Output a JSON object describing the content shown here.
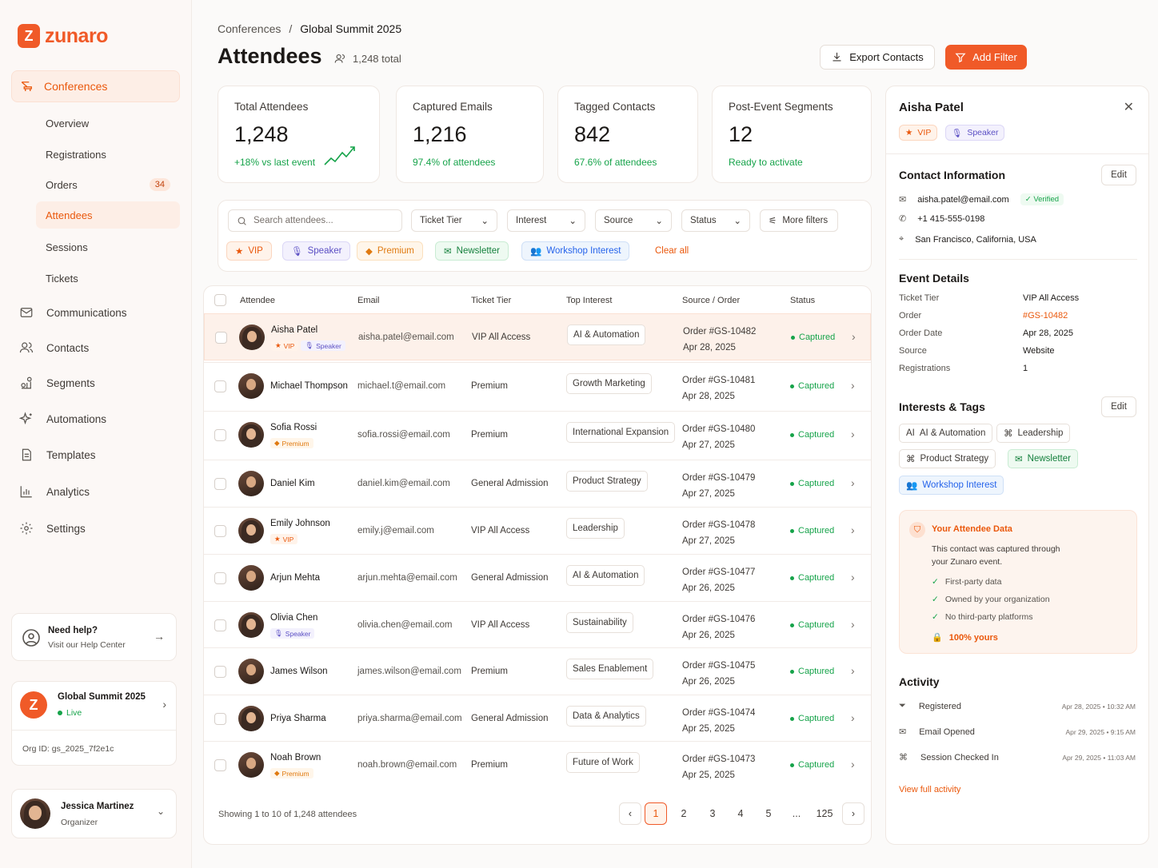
{
  "brand": {
    "name": "zunaro",
    "accent": "#f05a28"
  },
  "sidebar": {
    "main": "Conferences",
    "subitems": [
      {
        "label": "Overview"
      },
      {
        "label": "Registrations"
      },
      {
        "label": "Orders",
        "badge": "34"
      },
      {
        "label": "Attendees"
      },
      {
        "label": "Sessions"
      },
      {
        "label": "Tickets"
      }
    ],
    "items": [
      {
        "label": "Communications",
        "icon": "mail-icon"
      },
      {
        "label": "Contacts",
        "icon": "users-icon"
      },
      {
        "label": "Segments",
        "icon": "segments-icon"
      },
      {
        "label": "Automations",
        "icon": "sparkle-icon"
      },
      {
        "label": "Templates",
        "icon": "document-icon"
      },
      {
        "label": "Analytics",
        "icon": "bar-chart-icon"
      },
      {
        "label": "Settings",
        "icon": "gear-icon"
      }
    ],
    "help": {
      "title": "Need help?",
      "subtitle": "Visit our Help Center"
    },
    "event": {
      "name": "Global Summit 2025",
      "status": "Live",
      "org_id": "Org ID: gs_2025_7f2e1c"
    },
    "user": {
      "name": "Jessica Martinez",
      "role": "Organizer"
    }
  },
  "header": {
    "breadcrumb": [
      "Conferences",
      "/",
      "Global Summit 2025"
    ],
    "title": "Attendees",
    "total": "1,248 total",
    "export_label": "Export Contacts",
    "add_filter_label": "Add Filter"
  },
  "stats": [
    {
      "label": "Total Attendees",
      "value": "1,248",
      "sub": "+18% vs last event"
    },
    {
      "label": "Captured Emails",
      "value": "1,216",
      "sub": "97.4% of attendees"
    },
    {
      "label": "Tagged Contacts",
      "value": "842",
      "sub": "67.6% of attendees"
    },
    {
      "label": "Post-Event Segments",
      "value": "12",
      "sub": "Ready to activate"
    }
  ],
  "filters": {
    "search_placeholder": "Search attendees...",
    "dropdowns": [
      "Ticket Tier",
      "Interest",
      "Source",
      "Status"
    ],
    "more": "More filters",
    "chips": [
      "VIP",
      "Speaker",
      "Premium",
      "Newsletter",
      "Workshop Interest"
    ],
    "clear": "Clear all"
  },
  "table": {
    "columns": [
      "Attendee",
      "Email",
      "Ticket Tier",
      "Top Interest",
      "Source / Order",
      "Status"
    ],
    "rows": [
      {
        "name": "Aisha Patel",
        "tags": [
          "VIP",
          "Speaker"
        ],
        "email": "aisha.patel@email.com",
        "tier": "VIP All Access",
        "interest": "AI & Automation",
        "order": "Order #GS-10482",
        "date": "Apr 28, 2025",
        "status": "Captured"
      },
      {
        "name": "Michael Thompson",
        "tags": [],
        "email": "michael.t@email.com",
        "tier": "Premium",
        "interest": "Growth Marketing",
        "order": "Order #GS-10481",
        "date": "Apr 28, 2025",
        "status": "Captured"
      },
      {
        "name": "Sofia Rossi",
        "tags": [
          "Premium"
        ],
        "email": "sofia.rossi@email.com",
        "tier": "Premium",
        "interest": "International Expansion",
        "order": "Order #GS-10480",
        "date": "Apr 27, 2025",
        "status": "Captured"
      },
      {
        "name": "Daniel Kim",
        "tags": [],
        "email": "daniel.kim@email.com",
        "tier": "General Admission",
        "interest": "Product Strategy",
        "order": "Order #GS-10479",
        "date": "Apr 27, 2025",
        "status": "Captured"
      },
      {
        "name": "Emily Johnson",
        "tags": [
          "VIP"
        ],
        "email": "emily.j@email.com",
        "tier": "VIP All Access",
        "interest": "Leadership",
        "order": "Order #GS-10478",
        "date": "Apr 27, 2025",
        "status": "Captured"
      },
      {
        "name": "Arjun Mehta",
        "tags": [],
        "email": "arjun.mehta@email.com",
        "tier": "General Admission",
        "interest": "AI & Automation",
        "order": "Order #GS-10477",
        "date": "Apr 26, 2025",
        "status": "Captured"
      },
      {
        "name": "Olivia Chen",
        "tags": [
          "Speaker"
        ],
        "email": "olivia.chen@email.com",
        "tier": "VIP All Access",
        "interest": "Sustainability",
        "order": "Order #GS-10476",
        "date": "Apr 26, 2025",
        "status": "Captured"
      },
      {
        "name": "James Wilson",
        "tags": [],
        "email": "james.wilson@email.com",
        "tier": "Premium",
        "interest": "Sales Enablement",
        "order": "Order #GS-10475",
        "date": "Apr 26, 2025",
        "status": "Captured"
      },
      {
        "name": "Priya Sharma",
        "tags": [],
        "email": "priya.sharma@email.com",
        "tier": "General Admission",
        "interest": "Data & Analytics",
        "order": "Order #GS-10474",
        "date": "Apr 25, 2025",
        "status": "Captured"
      },
      {
        "name": "Noah Brown",
        "tags": [
          "Premium"
        ],
        "email": "noah.brown@email.com",
        "tier": "Premium",
        "interest": "Future of Work",
        "order": "Order #GS-10473",
        "date": "Apr 25, 2025",
        "status": "Captured"
      }
    ],
    "showing": "Showing 1 to 10 of 1,248 attendees",
    "pages": [
      "1",
      "2",
      "3",
      "4",
      "5",
      "...",
      "125"
    ]
  },
  "panel": {
    "name": "Aisha Patel",
    "tags": [
      "VIP",
      "Speaker"
    ],
    "contact_title": "Contact Information",
    "edit": "Edit",
    "email": "aisha.patel@email.com",
    "verified": "Verified",
    "phone": "+1 415-555-0198",
    "location": "San Francisco, California, USA",
    "event_title": "Event Details",
    "event_details": [
      {
        "k": "Ticket Tier",
        "v": "VIP All Access"
      },
      {
        "k": "Order",
        "v": "#GS-10482"
      },
      {
        "k": "Order Date",
        "v": "Apr 28, 2025"
      },
      {
        "k": "Source",
        "v": "Website"
      },
      {
        "k": "Registrations",
        "v": "1"
      }
    ],
    "interests_title": "Interests & Tags",
    "interests": [
      "AI & Automation",
      "Leadership",
      "Product Strategy",
      "Newsletter",
      "Workshop Interest"
    ],
    "data_title": "Your Attendee Data",
    "data_text_1": "This contact was captured through",
    "data_text_2": "your Zunaro event.",
    "data_checks": [
      "First-party data",
      "Owned by your organization",
      "No third-party platforms"
    ],
    "data_owned": "100% yours",
    "activity_title": "Activity",
    "activity": [
      {
        "label": "Registered",
        "time": "Apr 28, 2025  •  10:32 AM"
      },
      {
        "label": "Email Opened",
        "time": "Apr 29, 2025  •  9:15 AM"
      },
      {
        "label": "Session Checked In",
        "time": "Apr 29, 2025  •  11:03 AM"
      }
    ],
    "view_all": "View full activity"
  }
}
